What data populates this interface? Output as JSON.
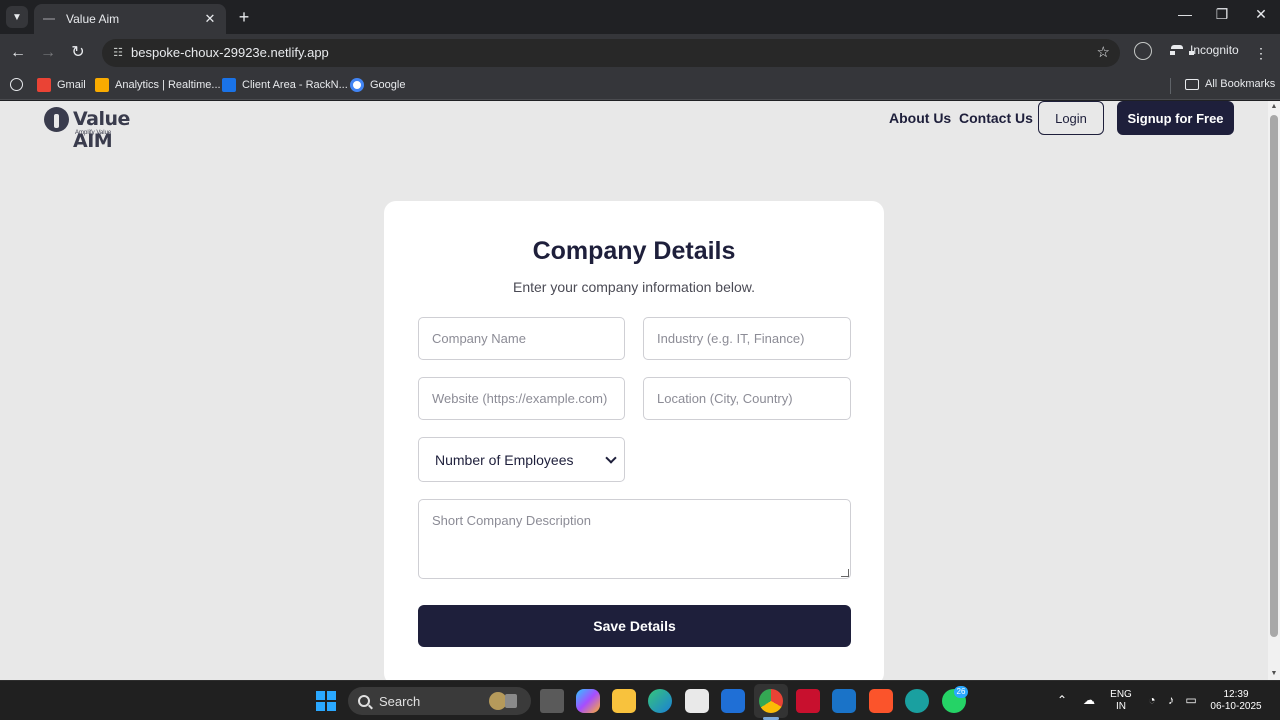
{
  "browser": {
    "tab_title": "Value Aim",
    "tab_close": "✕",
    "new_tab": "+",
    "url": "bespoke-choux-29923e.netlify.app",
    "mode_label": "Incognito",
    "bookmarks": [
      {
        "label": "Gmail",
        "icon": "gmail-icon",
        "color": "#ea4335"
      },
      {
        "label": "Analytics | Realtime...",
        "icon": "analytics-icon",
        "color": "#f9ab00"
      },
      {
        "label": "Client Area - RackN...",
        "icon": "racknerd-icon",
        "color": "#1a73e8"
      },
      {
        "label": "Google",
        "icon": "google-icon",
        "color": "#4285f4"
      }
    ],
    "all_bookmarks_label": "All Bookmarks"
  },
  "site": {
    "logo_text": "Value AIM",
    "logo_tagline": "Amplify Value",
    "nav": {
      "about": "About Us",
      "contact": "Contact Us",
      "login": "Login",
      "signup": "Signup for Free"
    }
  },
  "form": {
    "title": "Company Details",
    "subtitle": "Enter your company information below.",
    "company_name_placeholder": "Company Name",
    "industry_placeholder": "Industry (e.g. IT, Finance)",
    "website_placeholder": "Website (https://example.com)",
    "location_placeholder": "Location (City, Country)",
    "employees_selected": "Number of Employees",
    "description_placeholder": "Short Company Description",
    "save_label": "Save Details"
  },
  "taskbar": {
    "search_label": "Search",
    "notification_count": "26",
    "language": "ENG",
    "region": "IN",
    "time": "12:39",
    "date": "06-10-2025"
  },
  "colors": {
    "brand_navy": "#1e1f3b",
    "page_bg": "#e8e8e8",
    "card_bg": "#ffffff"
  }
}
